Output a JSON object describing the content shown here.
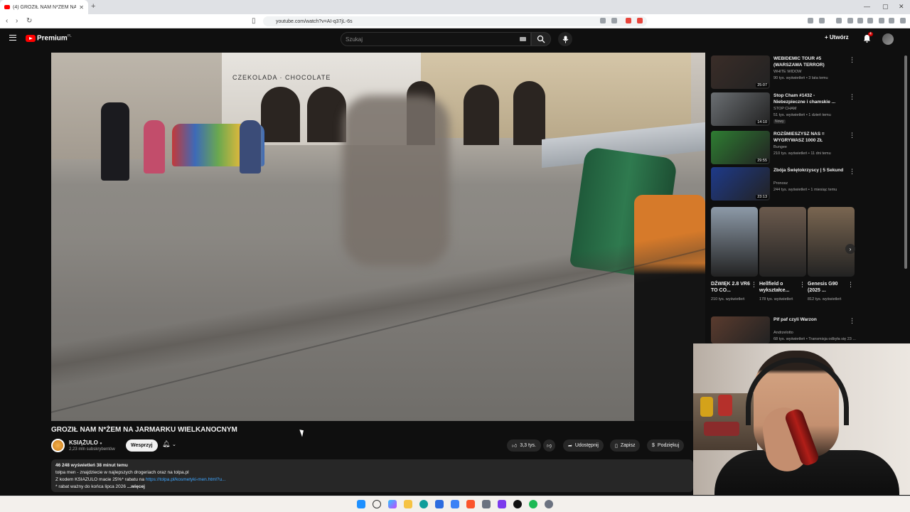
{
  "browser": {
    "tab_title": "(4) GROZIŁ NAM N*ŻEM NA...",
    "url": "youtube.com/watch?v=AI-q37jL-6s"
  },
  "header": {
    "premium_label": "Premium",
    "premium_country": "PL",
    "search_placeholder": "Szukaj",
    "create_label": "Utwórz",
    "notification_count": "4"
  },
  "video": {
    "title": "GROZIŁ NAM N*ŻEM NA JARMARKU WIELKANOCNYM",
    "shop_sign": "CZEKOLADA · CHOCOLATE",
    "channel_name": "KSIĄŻULO",
    "channel_subs": "2,23 mln subskrybentów",
    "support_label": "Wesprzyj",
    "likes": "3,3 tys.",
    "share_label": "Udostępnij",
    "save_label": "Zapisz",
    "thanks_label": "Podziękuj"
  },
  "description": {
    "stats": "46 248 wyświetleń  38 minut temu",
    "line1": "tołpa men - znajdziecie w najlepszych drogeriach oraz na tolpa.pl",
    "line2_prefix": "Z kodem KSIAZULO macie 25%* rabatu na ",
    "line2_link": "https://tolpa.pl/kosmetyki-men.html?u...",
    "line3": "* rabat ważny do końca lipca 2026",
    "more": "...więcej"
  },
  "recommendations": [
    {
      "title": "WEBIDEMIC TOUR #5 (WARSZAWA TERROR)",
      "channel": "WHITE WIDOW",
      "meta": "90 tys. wyświetleń • 3 lata temu",
      "duration": "25:07",
      "is_new": "",
      "thumb_color": "#3a2d28"
    },
    {
      "title": "Stop Cham #1432 - Niebezpieczne i chamskie ...",
      "channel": "STOP CHAM",
      "meta": "51 tys. wyświetleń • 1 dzień temu",
      "duration": "14:10",
      "is_new": "Nowy",
      "thumb_color": "#6b6f73"
    },
    {
      "title": "ROZŚMIESZYSZ NAS = WYGRYWASZ 1000 ZŁ",
      "channel": "Bungee",
      "meta": "210 tys. wyświetleń • 11 dni temu",
      "duration": "29:55",
      "is_new": "",
      "thumb_color": "#2e7d32"
    },
    {
      "title": "Zbója Świętokrzyscy | 5 Sekund",
      "channel": "Pronosz",
      "meta": "244 tys. wyświetleń • 1 miesiąc temu",
      "duration": "23:13",
      "is_new": "",
      "thumb_color": "#1e3a8a"
    },
    {
      "title": "Pif paf czyli Warzon",
      "channel": "Andrzelotto",
      "meta": "68 tys. wyświetleń • Transmisja odbyła się 23 ...",
      "duration": "",
      "is_new": "Nowy",
      "thumb_color": "#5a3b2e"
    }
  ],
  "shorts": [
    {
      "title": "DŹWIĘK 2.8 VR6 TO CO...",
      "views": "210 tys. wyświetleń",
      "color": "#8d9aa8"
    },
    {
      "title": "Hellfield o wykształce...",
      "views": "178 tys. wyświetleń",
      "color": "#6b5a4d"
    },
    {
      "title": "Genesis G90 (2025 ...",
      "views": "812 tys. wyświetleń",
      "color": "#7a6651"
    }
  ]
}
